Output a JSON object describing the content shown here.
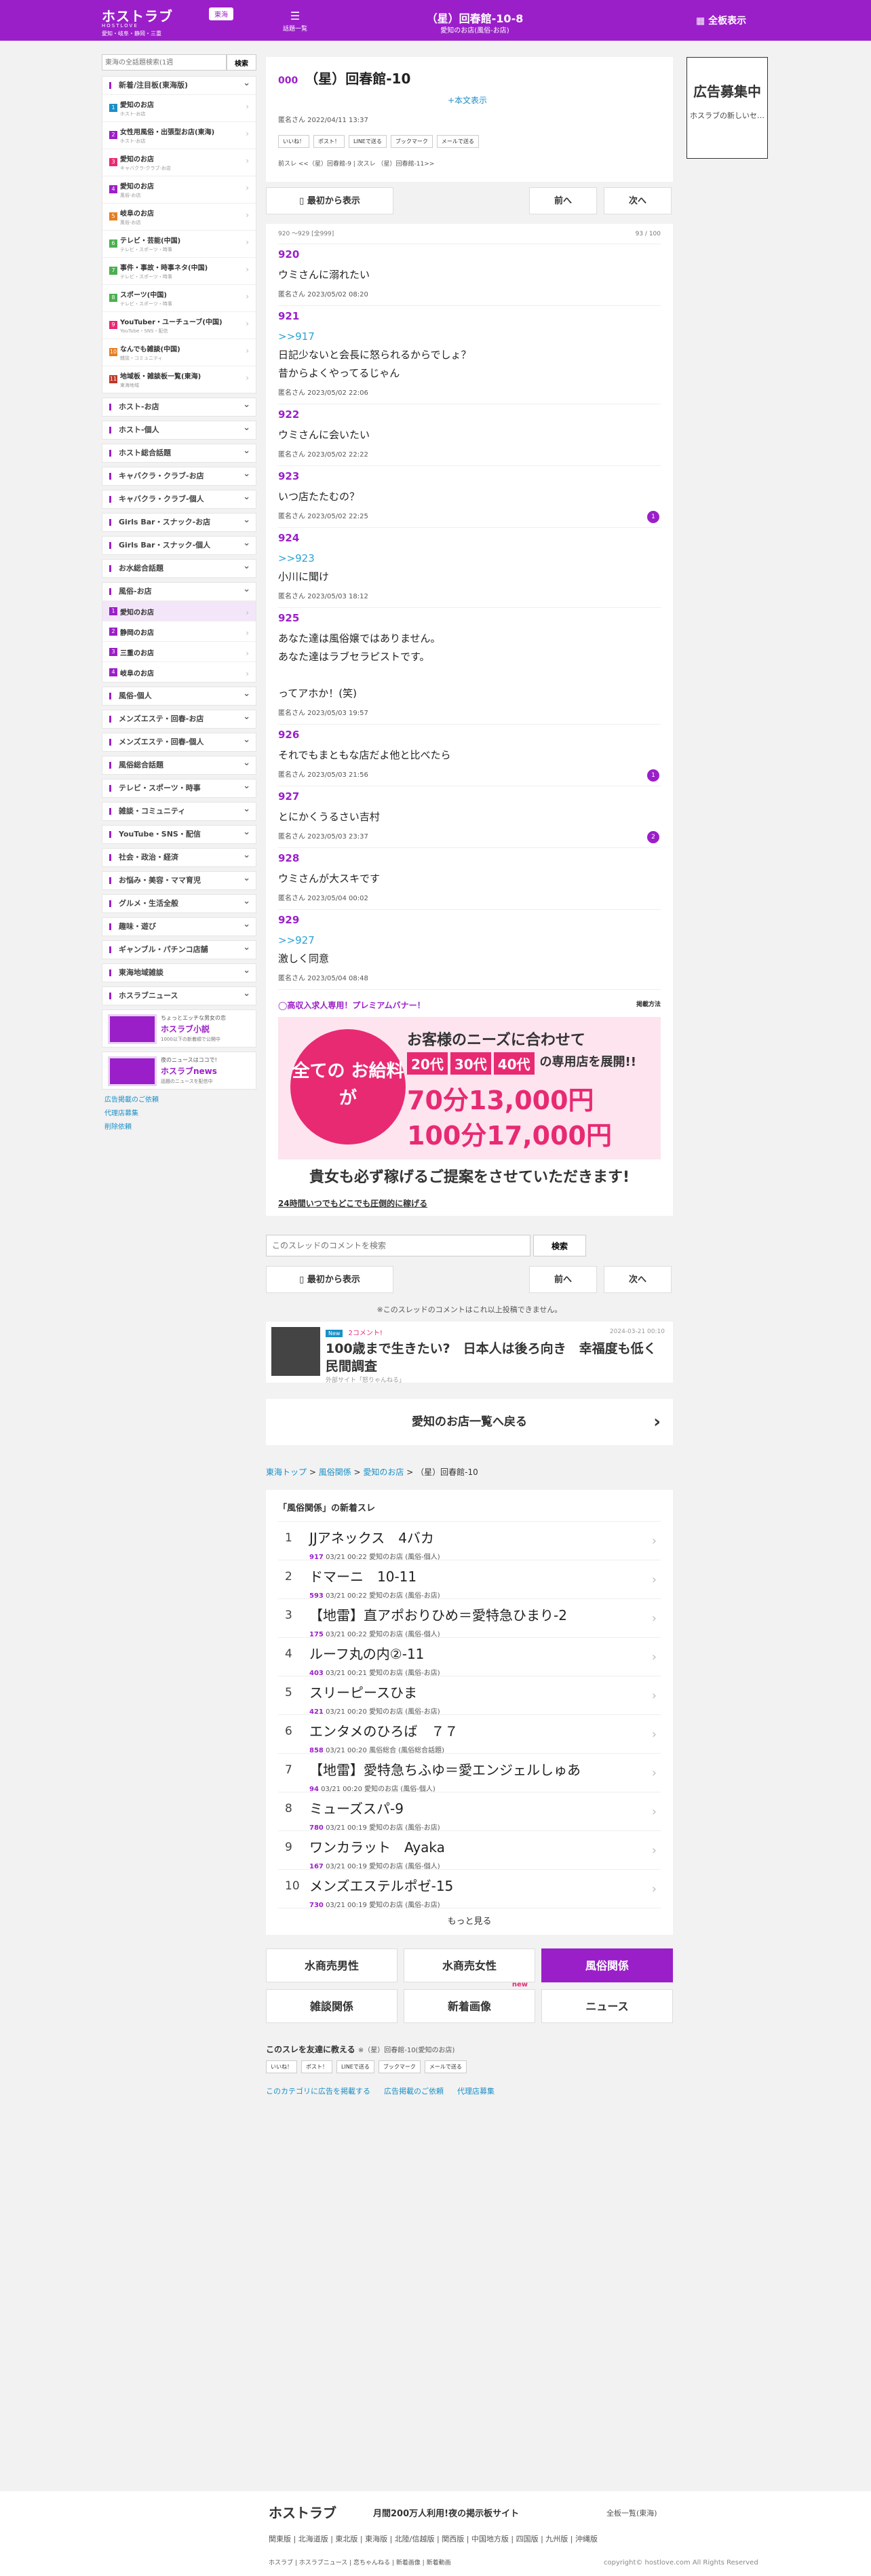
{
  "header": {
    "logo": "ホストラブ",
    "logo_sub": "HOSTLOVE",
    "region": "東海",
    "logo_regions": "愛知・岐阜・静岡・三重",
    "menu_label": "話題一覧",
    "title": "（星）回春館-10-8",
    "subtitle": "愛知のお店(風俗-お店)",
    "full_display": "全板表示"
  },
  "sidebar": {
    "search_placeholder": "東海の全話題検索(1週",
    "search_button": "検索",
    "featured_title": "新着/注目板(東海版)",
    "featured": [
      {
        "num": "1",
        "label": "愛知のお店",
        "sub": "ホスト-お店"
      },
      {
        "num": "2",
        "label": "女性用風俗・出張型お店(東海)",
        "sub": "ホスト-お店"
      },
      {
        "num": "3",
        "label": "愛知のお店",
        "sub": "キャバクラ-クラブ-お店"
      },
      {
        "num": "4",
        "label": "愛知のお店",
        "sub": "風俗-お店"
      },
      {
        "num": "5",
        "label": "岐阜のお店",
        "sub": "風俗-お店"
      },
      {
        "num": "6",
        "label": "テレビ・芸能(中国)",
        "sub": "テレビ・スポーツ・時事"
      },
      {
        "num": "7",
        "label": "事件・事故・時事ネタ(中国)",
        "sub": "テレビ・スポーツ・時事"
      },
      {
        "num": "8",
        "label": "スポーツ(中国)",
        "sub": "テレビ・スポーツ・時事"
      },
      {
        "num": "9",
        "label": "YouTuber・ユーチューブ(中国)",
        "sub": "YouTube・SNS・配信"
      },
      {
        "num": "10",
        "label": "なんでも雑談(中国)",
        "sub": "雑談・コミュニティ"
      },
      {
        "num": "11",
        "label": "地域板・雑談板一覧(東海)",
        "sub": "東海地域"
      }
    ],
    "cats_a": [
      "ホスト-お店",
      "ホスト-個人",
      "ホスト総合話題",
      "キャバクラ・クラブ-お店",
      "キャバクラ・クラブ-個人",
      "Girls Bar・スナック-お店",
      "Girls Bar・スナック-個人",
      "お水総合話題"
    ],
    "fuzoku_title": "風俗-お店",
    "fuzoku": [
      {
        "num": "1",
        "label": "愛知のお店"
      },
      {
        "num": "2",
        "label": "静岡のお店"
      },
      {
        "num": "3",
        "label": "三重のお店"
      },
      {
        "num": "4",
        "label": "岐阜のお店"
      }
    ],
    "cats_b": [
      "風俗-個人",
      "メンズエステ・回春-お店",
      "メンズエステ・回春-個人",
      "風俗総合話題",
      "テレビ・スポーツ・時事",
      "雑談・コミュニティ",
      "YouTube・SNS・配信",
      "社会・政治・経済",
      "お悩み・美容・ママ育児",
      "グルメ・生活全般",
      "趣味・遊び",
      "ギャンブル・パチンコ店舗",
      "東海地域雑談",
      "ホスラブニュース"
    ],
    "banners": [
      {
        "t1": "ちょっとエッチな男女の恋",
        "t2": "ホスラブ小説",
        "t3": "1000以下の新着順で公開中"
      },
      {
        "t1": "夜のニュースはココで!",
        "t2": "ホスラブnews",
        "t3": "話題のニュースを配信中"
      }
    ],
    "links": [
      "広告掲載のご依頼",
      "代理店募集",
      "削除依頼"
    ]
  },
  "thread": {
    "no": "000",
    "title": "（星）回春館-10",
    "show_body": "+本文表示",
    "meta": "匿名さん 2022/04/11 13:37",
    "share": [
      "いいね！",
      "ポスト！",
      "LINEで送る",
      "ブックマーク",
      "メールで送る"
    ],
    "prev_next": "前スレ <<（星）回春館-9 | 次スレ （星）回春館-11>>"
  },
  "nav": {
    "first": "最初から表示",
    "prev": "前へ",
    "next": "次へ"
  },
  "posts_header": {
    "range": "920 〜929 [全999]",
    "page": "93 / 100"
  },
  "posts": [
    {
      "no": "920",
      "ref": "",
      "body": [
        "ウミさんに溺れたい"
      ],
      "meta": "匿名さん 2023/05/02 08:20",
      "count": ""
    },
    {
      "no": "921",
      "ref": ">>917",
      "body": [
        "日記少ないと会長に怒られるからでしょ？",
        "昔からよくやってるじゃん"
      ],
      "meta": "匿名さん 2023/05/02 22:06",
      "count": ""
    },
    {
      "no": "922",
      "ref": "",
      "body": [
        "ウミさんに会いたい"
      ],
      "meta": "匿名さん 2023/05/02 22:22",
      "count": ""
    },
    {
      "no": "923",
      "ref": "",
      "body": [
        "いつ店たたむの？"
      ],
      "meta": "匿名さん 2023/05/02 22:25",
      "count": "1"
    },
    {
      "no": "924",
      "ref": ">>923",
      "body": [
        "小川に聞け"
      ],
      "meta": "匿名さん 2023/05/03 18:12",
      "count": ""
    },
    {
      "no": "925",
      "ref": "",
      "body": [
        "あなた達は風俗嬢ではありません。",
        "あなた達はラブセラピストです。",
        "",
        "ってアホか！(笑)"
      ],
      "meta": "匿名さん 2023/05/03 19:57",
      "count": ""
    },
    {
      "no": "926",
      "ref": "",
      "body": [
        "それでもまともな店だよ他と比べたら"
      ],
      "meta": "匿名さん 2023/05/03 21:56",
      "count": "1"
    },
    {
      "no": "927",
      "ref": "",
      "body": [
        "とにかくうるさい吉村"
      ],
      "meta": "匿名さん 2023/05/03 23:37",
      "count": "2"
    },
    {
      "no": "928",
      "ref": "",
      "body": [
        "ウミさんが大スキです"
      ],
      "meta": "匿名さん 2023/05/04 00:02",
      "count": ""
    },
    {
      "no": "929",
      "ref": ">>927",
      "body": [
        "激しく同意"
      ],
      "meta": "匿名さん 2023/05/04 08:48",
      "count": ""
    }
  ],
  "premium": {
    "heading": "◯高収入求人専用！プレミアムバナー！",
    "method": "掲載方法",
    "circle": "全ての お給料が",
    "t1": "お客様のニーズに合わせて",
    "ages": [
      "20代",
      "30代",
      "40代"
    ],
    "ages_tail": "の専用店を展開!!",
    "pay1": "70分13,000円",
    "pay2": "100分17,000円",
    "caption": "貴女も必ず稼げるご提案をさせていただきます!",
    "sub": "24時間いつでもどこでも圧倒的に稼げる"
  },
  "comment": {
    "placeholder": "このスレッドのコメントを検索",
    "button": "検索"
  },
  "limit_note": "※このスレッドのコメントはこれ以上投稿できません。",
  "news": {
    "badge": "New",
    "comments": "2コメント!",
    "date": "2024-03-21 00:10",
    "title": "100歳まで生きたい?　日本人は後ろ向き　幸福度も低く　民間調査",
    "source": "外部サイト「怒りゃんねる」"
  },
  "back_label": "愛知のお店一覧へ戻る",
  "breadcrumb": {
    "top": "東海トップ",
    "cat": "風俗関係",
    "board": "愛知のお店",
    "current": "（星）回春館-10"
  },
  "new_threads": {
    "title": "「風俗関係」の新着スレ",
    "items": [
      {
        "n": "1",
        "t": "JJアネックス　4バカ",
        "c": "917",
        "d": "03/21 00:22",
        "b": "愛知のお店 (風俗-個人)"
      },
      {
        "n": "2",
        "t": "ドマーニ　10-11",
        "c": "593",
        "d": "03/21 00:22",
        "b": "愛知のお店 (風俗-お店)"
      },
      {
        "n": "3",
        "t": "【地雷】直アポおりひめ＝愛特急ひまり-2",
        "c": "175",
        "d": "03/21 00:22",
        "b": "愛知のお店 (風俗-個人)"
      },
      {
        "n": "4",
        "t": "ルーフ丸の内②-11",
        "c": "403",
        "d": "03/21 00:21",
        "b": "愛知のお店 (風俗-お店)"
      },
      {
        "n": "5",
        "t": "スリーピースひま",
        "c": "421",
        "d": "03/21 00:20",
        "b": "愛知のお店 (風俗-お店)"
      },
      {
        "n": "6",
        "t": "エンタメのひろば　７７",
        "c": "858",
        "d": "03/21 00:20",
        "b": "風俗総合 (風俗総合話題)"
      },
      {
        "n": "7",
        "t": "【地雷】愛特急ちふゆ＝愛エンジェルしゅあ",
        "c": "94",
        "d": "03/21 00:20",
        "b": "愛知のお店 (風俗-個人)"
      },
      {
        "n": "8",
        "t": "ミューズスパ-9",
        "c": "780",
        "d": "03/21 00:19",
        "b": "愛知のお店 (風俗-お店)"
      },
      {
        "n": "9",
        "t": "ワンカラット　Ayaka",
        "c": "167",
        "d": "03/21 00:19",
        "b": "愛知のお店 (風俗-個人)"
      },
      {
        "n": "10",
        "t": "メンズエステルポゼ-15",
        "c": "730",
        "d": "03/21 00:19",
        "b": "愛知のお店 (風俗-お店)"
      }
    ],
    "more": "もっと見る"
  },
  "categories": [
    "水商売男性",
    "水商売女性",
    "風俗関係",
    "雑談関係",
    "新着画像",
    "ニュース"
  ],
  "cat_new": "new",
  "footer_share": {
    "title": "このスレを友達に教える",
    "sub": "※（星）回春館-10(愛知のお店)",
    "buttons": [
      "いいね！",
      "ポスト！",
      "LINEで送る",
      "ブックマーク",
      "メールで送る"
    ],
    "links": [
      "このカテゴリに広告を掲載する",
      "広告掲載のご依頼",
      "代理店募集"
    ]
  },
  "right_ad": {
    "title": "広告募集中",
    "sub": "ホスラブの新しいセ…"
  },
  "footer": {
    "logo": "ホストラブ",
    "catch": "月間200万人利用!夜の掲示板サイト",
    "all": "全板一覧(東海)",
    "regions": "関東版 | 北海道版 | 東北版 | 東海版 | 北陸/信越版 | 関西版 | 中国地方版 | 四国版 | 九州版 | 沖縄版",
    "icons": "ホスラブ | ホスラブニュース | 恋ちゃんねる | 新着画像 | 新着動画",
    "copyright": "copyright© hostlove.com All Rights Reserved"
  }
}
